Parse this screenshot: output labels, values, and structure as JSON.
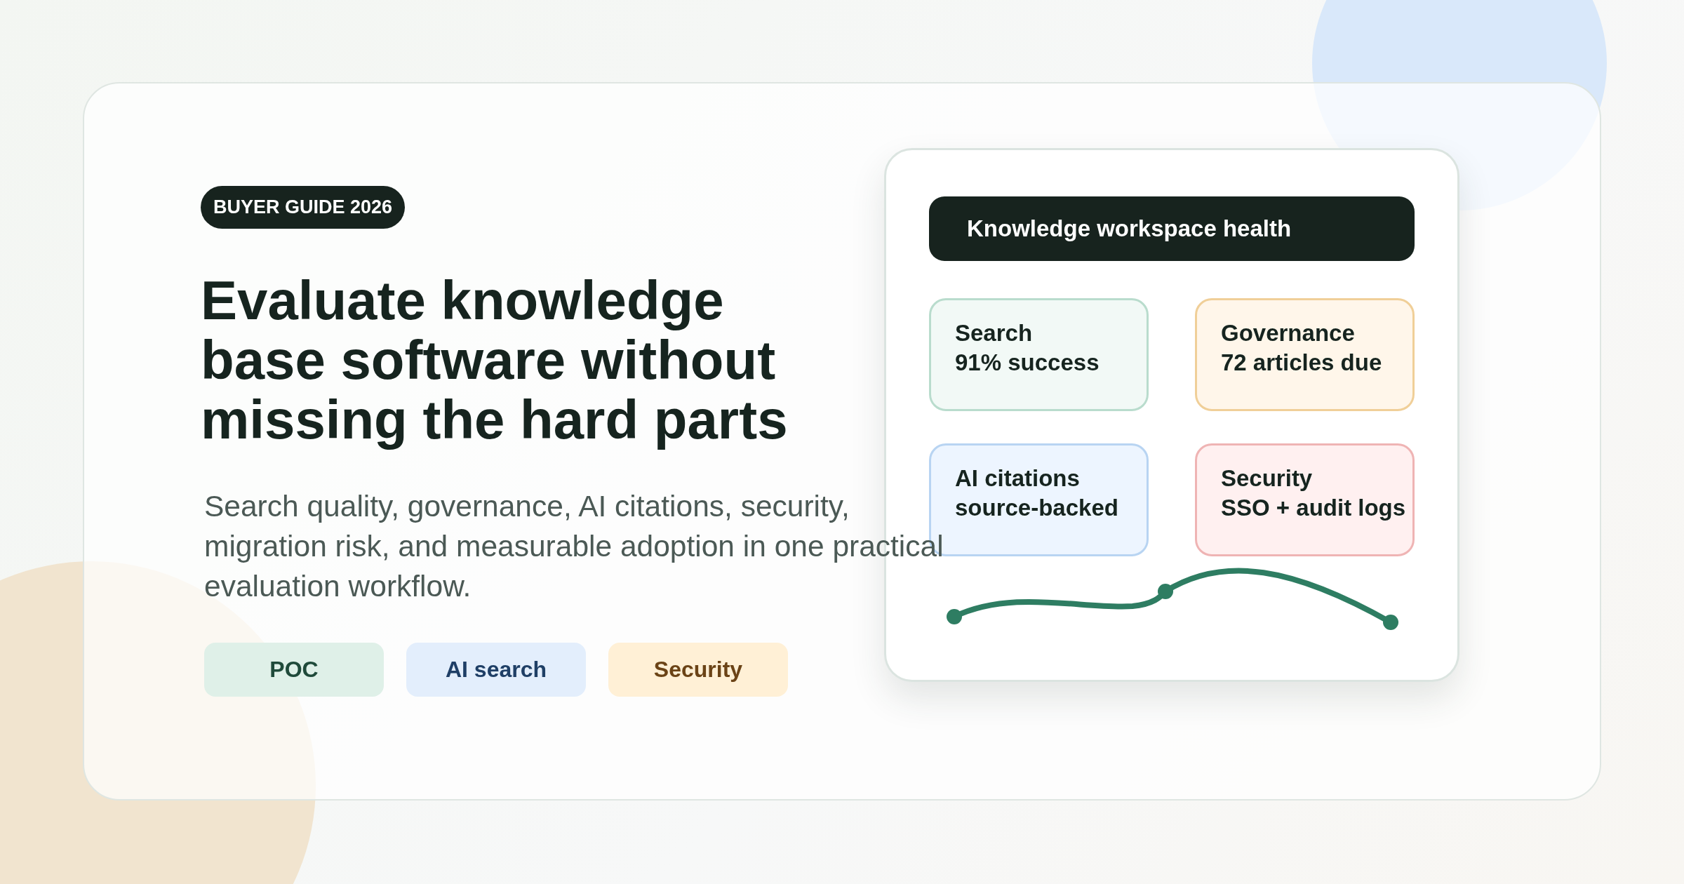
{
  "badge": "BUYER GUIDE 2026",
  "heading": "Evaluate knowledge base software without missing the hard parts",
  "description": "Search quality, governance, AI citations, security, migration risk, and measurable adoption in one practical evaluation workflow.",
  "tags": [
    {
      "label": "POC",
      "color": "#dff0e8"
    },
    {
      "label": "AI search",
      "color": "#e3eefc"
    },
    {
      "label": "Security",
      "color": "#fff0d6"
    }
  ],
  "panel": {
    "title": "Knowledge workspace health",
    "tiles": [
      {
        "title": "Search",
        "detail": "91% success",
        "color": "#b9dccd"
      },
      {
        "title": "Governance",
        "detail": "72 articles due",
        "color": "#f0cf98"
      },
      {
        "title": "AI citations",
        "detail": "source-backed",
        "color": "#b8d4f2"
      },
      {
        "title": "Security",
        "detail": "SSO + audit logs",
        "color": "#efb4b4"
      }
    ]
  }
}
